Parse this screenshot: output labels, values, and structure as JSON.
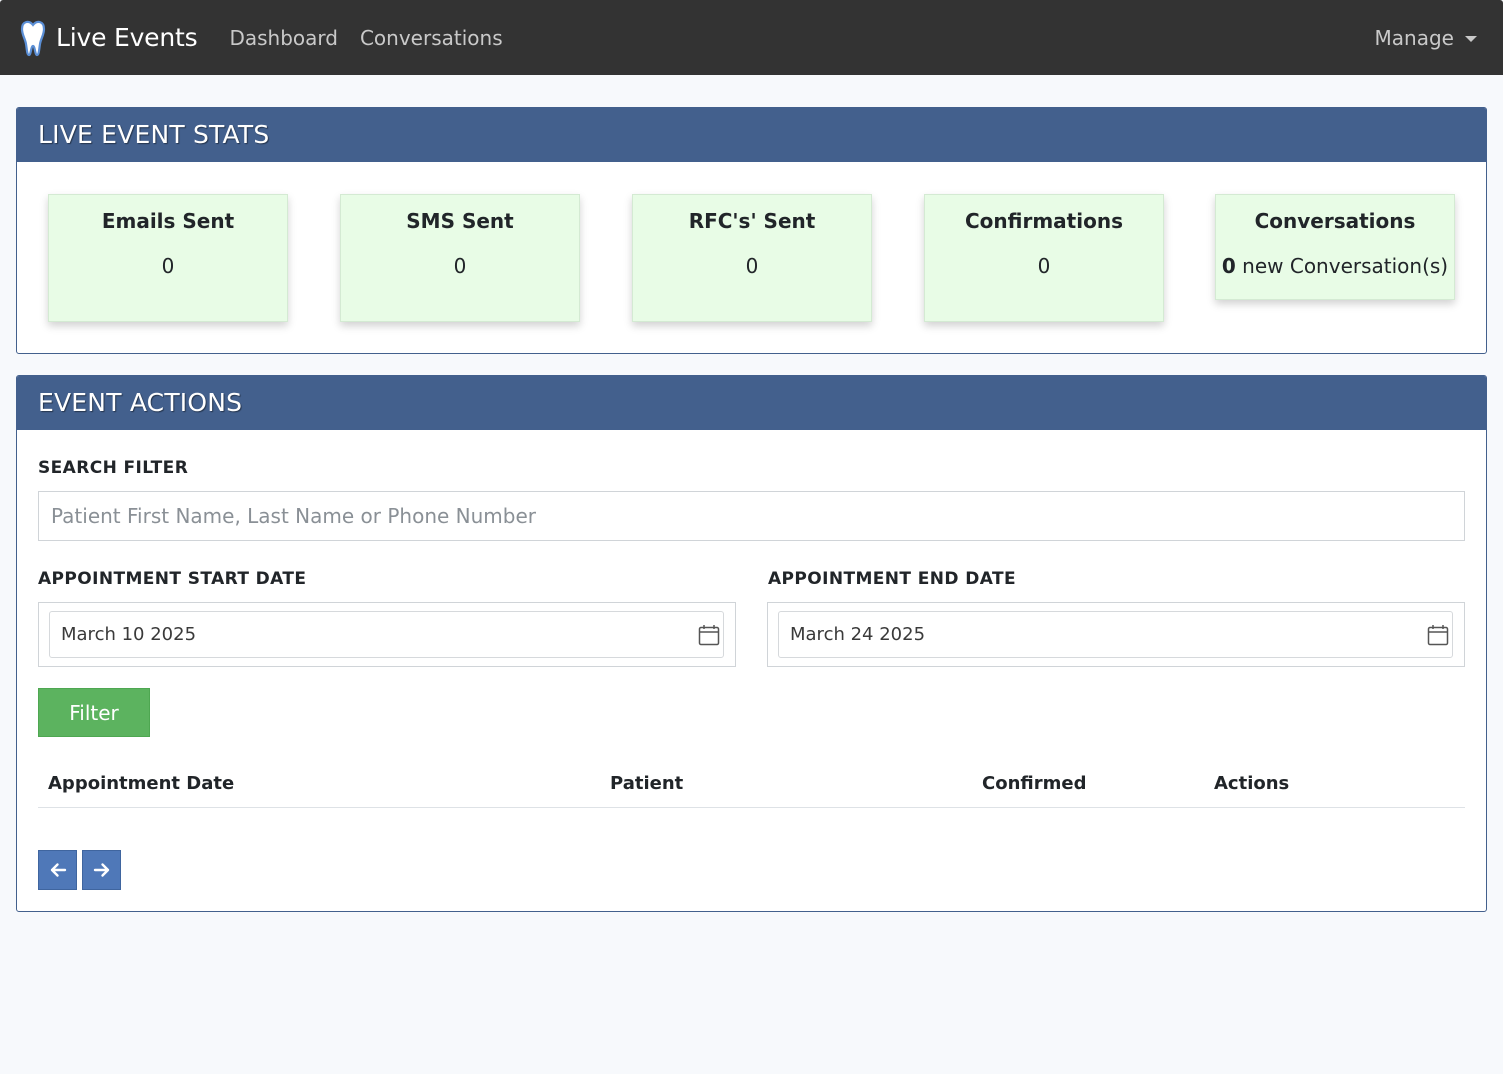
{
  "navbar": {
    "brand": "Live Events",
    "links": [
      "Dashboard",
      "Conversations"
    ],
    "manage_label": "Manage",
    "brand_icon": "tooth-icon"
  },
  "stats": {
    "title": "LIVE EVENT STATS",
    "cards": [
      {
        "title": "Emails Sent",
        "value": "0"
      },
      {
        "title": "SMS Sent",
        "value": "0"
      },
      {
        "title": "RFC's' Sent",
        "value": "0"
      },
      {
        "title": "Confirmations",
        "value": "0"
      },
      {
        "title": "Conversations",
        "value": "0",
        "suffix": " new Conversation(s)"
      }
    ]
  },
  "actions": {
    "title": "EVENT ACTIONS",
    "search_label": "SEARCH FILTER",
    "search_placeholder": "Patient First Name, Last Name or Phone Number",
    "search_value": "",
    "start_label": "APPOINTMENT START DATE",
    "start_value": "March 10 2025",
    "end_label": "APPOINTMENT END DATE",
    "end_value": "March 24 2025",
    "filter_label": "Filter",
    "table_headers": [
      "Appointment Date",
      "Patient",
      "Confirmed",
      "Actions"
    ],
    "table_rows": []
  },
  "colors": {
    "navbar": "#333333",
    "panel_header": "#43608d",
    "card_bg": "#e8fce6",
    "filter_button": "#5cb35f",
    "pager_button": "#4f78b8"
  }
}
